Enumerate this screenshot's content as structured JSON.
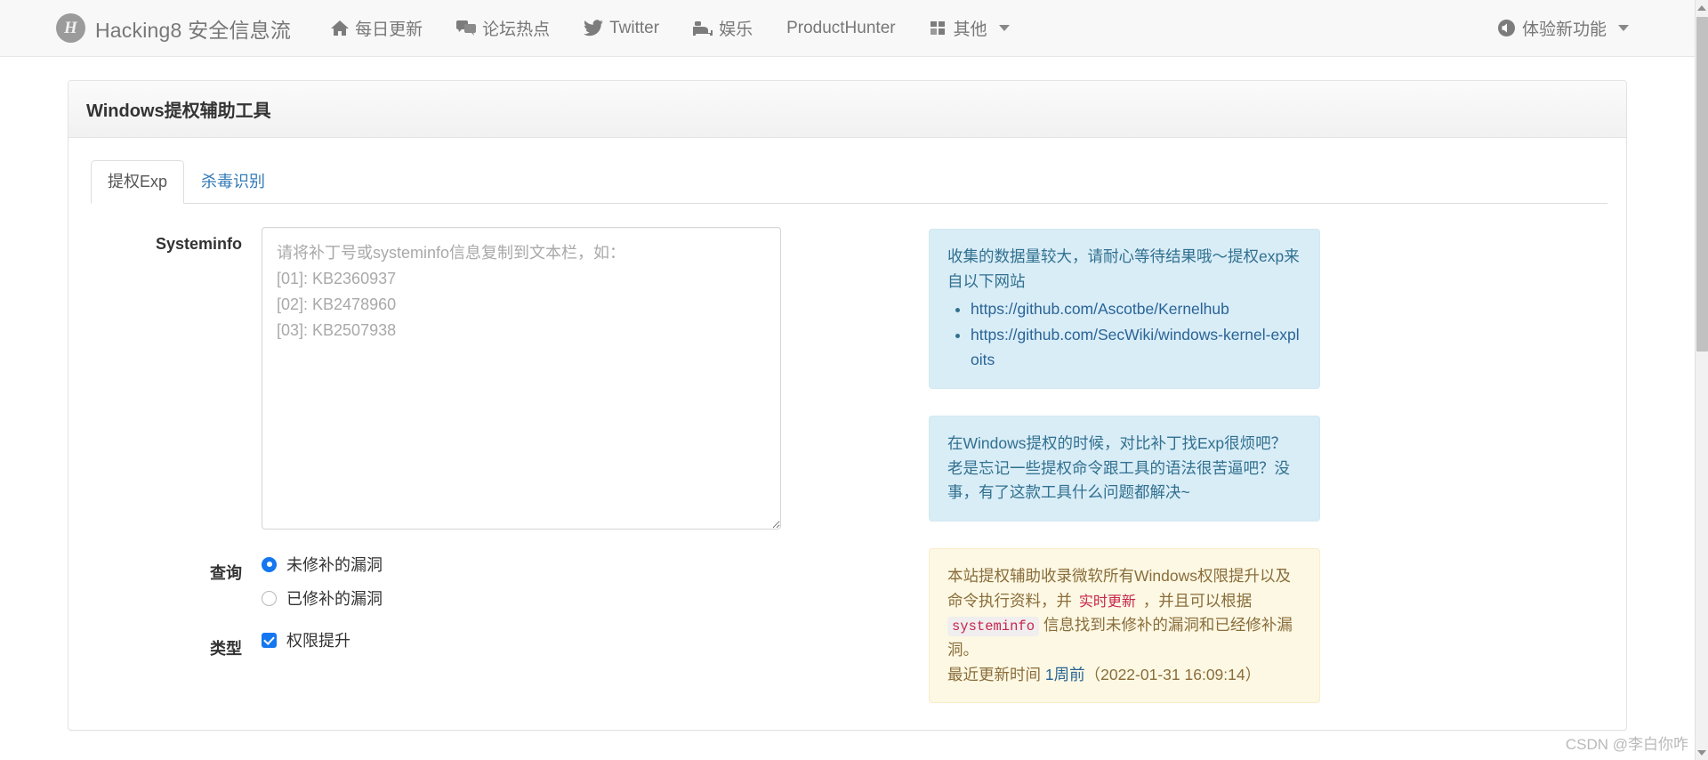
{
  "navbar": {
    "brand": {
      "logo_text": "H",
      "label": "Hacking8 安全信息流"
    },
    "items": [
      {
        "icon": "home-icon",
        "label": "每日更新"
      },
      {
        "icon": "comments-icon",
        "label": "论坛热点"
      },
      {
        "icon": "twitter-icon",
        "label": "Twitter"
      },
      {
        "icon": "bed-icon",
        "label": "娱乐"
      },
      {
        "icon": "none",
        "label": "ProductHunter"
      },
      {
        "icon": "th-large-icon",
        "label": "其他",
        "has_caret": true
      }
    ],
    "right": {
      "icon": "volume-icon",
      "label": "体验新功能",
      "has_caret": true
    }
  },
  "panel": {
    "title": "Windows提权辅助工具",
    "tabs": [
      {
        "label": "提权Exp",
        "active": true
      },
      {
        "label": "杀毒识别",
        "active": false
      }
    ]
  },
  "form": {
    "systeminfo_label": "Systeminfo",
    "systeminfo_value": "",
    "systeminfo_placeholder": "请将补丁号或systeminfo信息复制到文本栏，如：\n[01]: KB2360937\n[02]: KB2478960\n[03]: KB2507938",
    "query_label": "查询",
    "query_options": [
      {
        "label": "未修补的漏洞",
        "selected": true
      },
      {
        "label": "已修补的漏洞",
        "selected": false
      }
    ],
    "type_label": "类型",
    "type_options": [
      {
        "label": "权限提升",
        "checked": true
      }
    ]
  },
  "alerts": {
    "info1": {
      "text": "收集的数据量较大，请耐心等待结果哦～提权exp来自以下网站",
      "links": [
        "https://github.com/Ascotbe/Kernelhub",
        "https://github.com/SecWiki/windows-kernel-exploits"
      ]
    },
    "info2": {
      "text": "在Windows提权的时候，对比补丁找Exp很烦吧？老是忘记一些提权命令跟工具的语法很苦逼吧？没事，有了这款工具什么问题都解决~"
    },
    "warning": {
      "part1": "本站提权辅助收录微软所有Windows权限提升以及命令执行资料，并 ",
      "highlight": "实时更新",
      "part2": " ，并且可以根据 ",
      "code": "systeminfo",
      "part3": " 信息找到未修补的漏洞和已经修补漏洞。",
      "footer_prefix": "最近更新时间",
      "footer_link": "1周前",
      "footer_suffix": "（2022-01-31 16:09:14）"
    }
  },
  "watermark": {
    "text": "CSDN @李白你咋"
  },
  "colors": {
    "accent_blue": "#337ab7",
    "radio_blue": "#1477f0",
    "info_bg": "#d9edf7",
    "warning_bg": "#fcf8e3",
    "navbar_bg": "#f8f8f8"
  }
}
